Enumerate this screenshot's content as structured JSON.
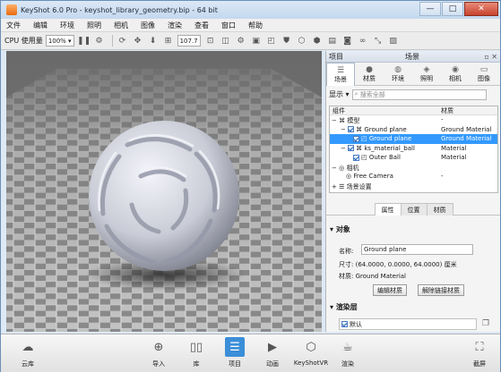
{
  "window": {
    "title": "KeyShot 6.0 Pro - keyshot_library_geometry.bip - 64 bit",
    "buttons": {
      "minimize": "—",
      "maximize": "□",
      "close": "✕"
    }
  },
  "menu": [
    "文件",
    "编辑",
    "环境",
    "照明",
    "相机",
    "图像",
    "渲染",
    "查看",
    "窗口",
    "帮助"
  ],
  "toolbar": {
    "cpu_label": "CPU 使用量",
    "cpu_value": "100%",
    "fov_value": "107.7"
  },
  "panel": {
    "header_left": "项目",
    "header_center": "场景",
    "tabs": [
      "场景",
      "材质",
      "环境",
      "照明",
      "相机",
      "图像"
    ],
    "display_label": "显示",
    "search_placeholder": "搜索全部"
  },
  "tree": {
    "col_component": "组件",
    "col_material": "材质",
    "rows": [
      {
        "name": "模型",
        "material": "-"
      },
      {
        "name": "Ground plane",
        "material": "Ground Material"
      },
      {
        "name": "Ground plane",
        "material": "Ground Material"
      },
      {
        "name": "ks_material_ball",
        "material": "Material"
      },
      {
        "name": "Outer Ball",
        "material": "Material"
      },
      {
        "name": "相机",
        "material": ""
      },
      {
        "name": "Free Camera",
        "material": "-"
      },
      {
        "name": "场景设置",
        "material": ""
      }
    ]
  },
  "props": {
    "subtabs": [
      "属性",
      "位置",
      "材质"
    ],
    "section_object": "对象",
    "name_label": "名称:",
    "name_value": "Ground plane",
    "size_label": "尺寸:",
    "size_value": "(64.0000, 0.0000, 64.0000) 厘米",
    "material_label": "材质:",
    "material_value": "Ground Material",
    "edit_material": "编辑材质",
    "unlink_material": "解除链接材质",
    "section_layers": "渲染层",
    "layer_default": "默认"
  },
  "bottom": {
    "items": [
      "云库",
      "导入",
      "库",
      "项目",
      "动画",
      "KeyShotVR",
      "渲染",
      "截屏"
    ],
    "active": "项目"
  },
  "colors": {
    "accent": "#3b8ed8",
    "selection": "#3399ff"
  }
}
